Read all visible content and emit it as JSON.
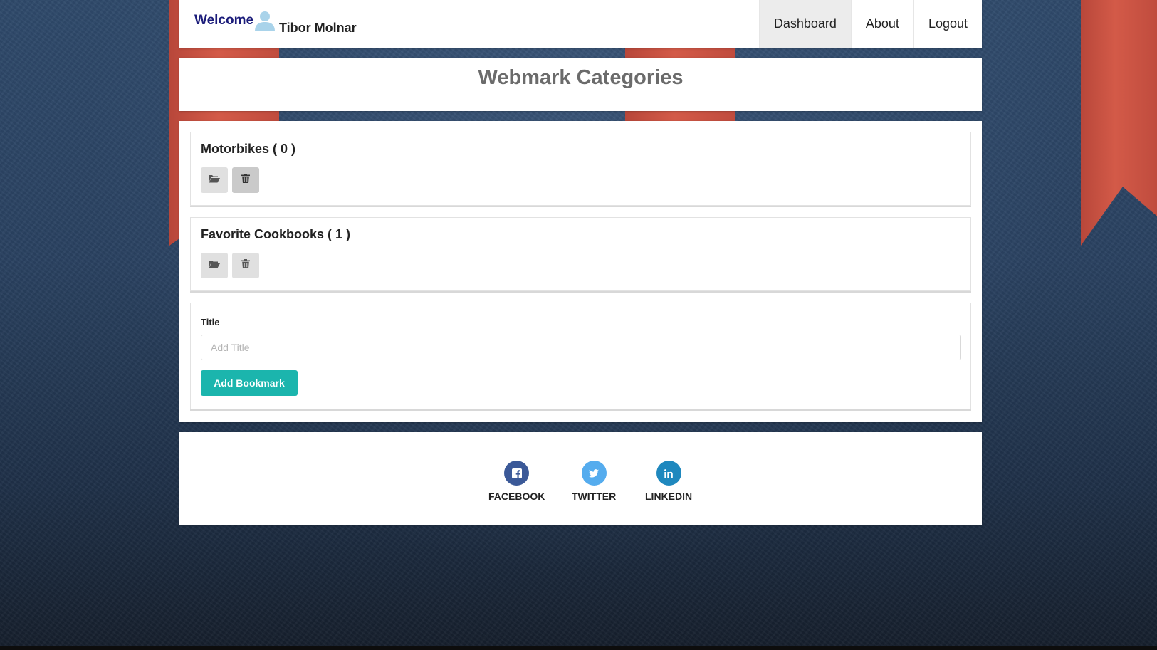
{
  "navbar": {
    "welcome": "Welcome",
    "user_name": "Tibor Molnar",
    "items": [
      {
        "label": "Dashboard",
        "active": true
      },
      {
        "label": "About",
        "active": false
      },
      {
        "label": "Logout",
        "active": false
      }
    ]
  },
  "page": {
    "title": "Webmark Categories"
  },
  "categories": [
    {
      "name": "Motorbikes ( 0 )",
      "actions": [
        "open-folder-icon",
        "trash-icon"
      ]
    },
    {
      "name": "Favorite Cookbooks ( 1 )",
      "actions": [
        "open-folder-icon",
        "trash-icon"
      ]
    }
  ],
  "form": {
    "label": "Title",
    "placeholder": "Add Title",
    "value": "",
    "submit_label": "Add Bookmark"
  },
  "footer": {
    "social": [
      {
        "label": "FACEBOOK",
        "icon": "facebook-icon",
        "color": "#3b5998"
      },
      {
        "label": "TWITTER",
        "icon": "twitter-icon",
        "color": "#55acee"
      },
      {
        "label": "LINKEDIN",
        "icon": "linkedin-icon",
        "color": "#1f88be"
      }
    ]
  },
  "colors": {
    "welcome_text": "#1b1c7a",
    "accent_button": "#1bb5ad",
    "title_text": "#6b6b6b",
    "ribbon": "#d35a48"
  }
}
